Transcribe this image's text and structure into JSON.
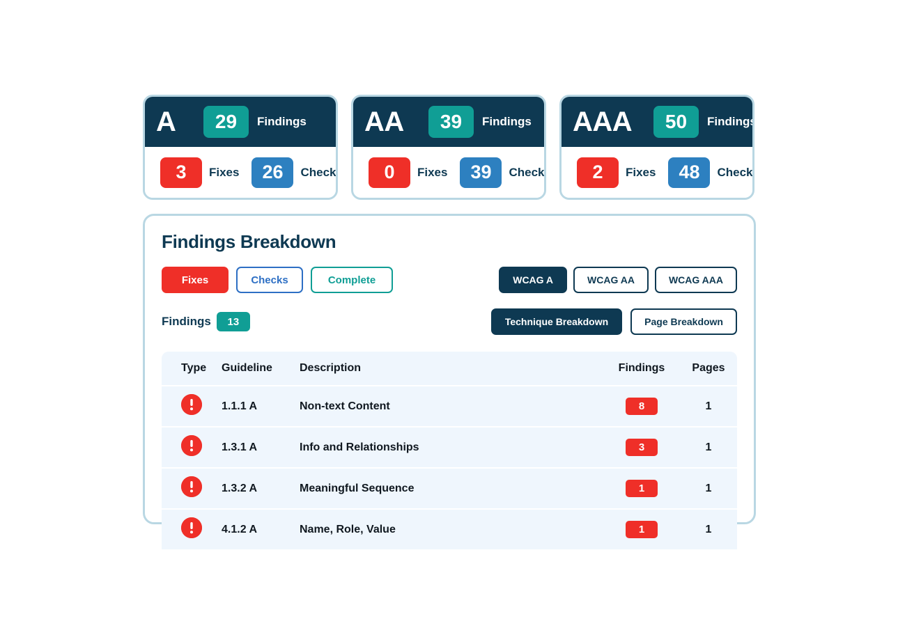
{
  "summary_cards": [
    {
      "level": "A",
      "findings_count": "29",
      "findings_label": "Findings",
      "fixes_count": "3",
      "fixes_label": "Fixes",
      "checks_count": "26",
      "checks_label": "Checks"
    },
    {
      "level": "AA",
      "findings_count": "39",
      "findings_label": "Findings",
      "fixes_count": "0",
      "fixes_label": "Fixes",
      "checks_count": "39",
      "checks_label": "Checks"
    },
    {
      "level": "AAA",
      "findings_count": "50",
      "findings_label": "Findings",
      "fixes_count": "2",
      "fixes_label": "Fixes",
      "checks_count": "48",
      "checks_label": "Checks"
    }
  ],
  "panel": {
    "title": "Findings Breakdown",
    "status_filters": [
      {
        "label": "Fixes",
        "active": true,
        "style": "red-solid"
      },
      {
        "label": "Checks",
        "active": false,
        "style": "blue-out"
      },
      {
        "label": "Complete",
        "active": false,
        "style": "teal-out"
      }
    ],
    "wcag_filters": [
      {
        "label": "WCAG A",
        "active": true
      },
      {
        "label": "WCAG AA",
        "active": false
      },
      {
        "label": "WCAG AAA",
        "active": false
      }
    ],
    "findings_word": "Findings",
    "findings_total": "13",
    "breakdown_tabs": [
      {
        "label": "Technique Breakdown",
        "active": true
      },
      {
        "label": "Page Breakdown",
        "active": false
      }
    ],
    "table": {
      "columns": [
        "Type",
        "Guideline",
        "Description",
        "Findings",
        "Pages"
      ],
      "rows": [
        {
          "type_icon": "error-icon",
          "guideline": "1.1.1 A",
          "description": "Non-text Content",
          "findings": "8",
          "pages": "1"
        },
        {
          "type_icon": "error-icon",
          "guideline": "1.3.1 A",
          "description": "Info and Relationships",
          "findings": "3",
          "pages": "1"
        },
        {
          "type_icon": "error-icon",
          "guideline": "1.3.2 A",
          "description": "Meaningful Sequence",
          "findings": "1",
          "pages": "1"
        },
        {
          "type_icon": "error-icon",
          "guideline": "4.1.2 A",
          "description": "Name, Role, Value",
          "findings": "1",
          "pages": "1"
        }
      ]
    }
  },
  "colors": {
    "navy": "#0e3952",
    "teal": "#109e95",
    "red": "#ef2f28",
    "blue": "#2d80c0",
    "blue_text": "#2d6fc4",
    "card_border": "#b9d7e3",
    "row_bg": "#eff6fd"
  }
}
